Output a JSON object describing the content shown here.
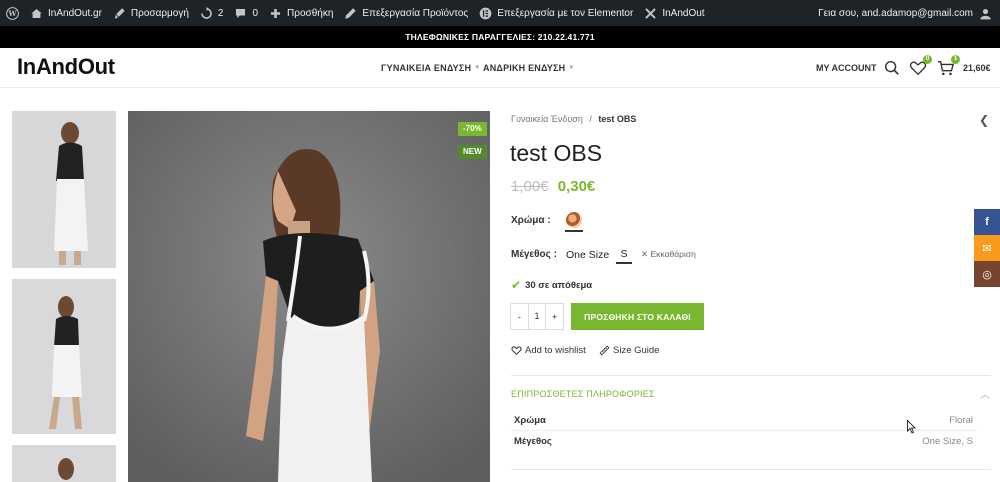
{
  "admin_bar": {
    "items": [
      {
        "icon": "wordpress-logo-icon",
        "label": ""
      },
      {
        "icon": "home-icon",
        "label": "InAndOut.gr"
      },
      {
        "icon": "paintbrush-icon",
        "label": "Προσαρμογή"
      },
      {
        "icon": "refresh-icon",
        "label": "2"
      },
      {
        "icon": "comment-icon",
        "label": "0"
      },
      {
        "icon": "plus-icon",
        "label": "Προσθήκη"
      },
      {
        "icon": "pencil-icon",
        "label": "Επεξεργασία Προϊόντος"
      },
      {
        "icon": "elementor-icon",
        "label": "Επεξεργασία με τον Elementor"
      },
      {
        "icon": "woodmart-icon",
        "label": "InAndOut"
      }
    ],
    "greeting": "Γεια σου, and.adamop@gmail.com"
  },
  "announcement": "ΤΗΛΕΦΩΝΙΚΕΣ ΠΑΡΑΓΓΕΛΙΕΣ: 210.22.41.771",
  "header": {
    "logo": "InAndOut",
    "nav": [
      "ΓΥΝΑΙΚΕΙΑ ΕΝΔΥΣΗ",
      "ΑΝΔΡΙΚΗ ΕΝΔΥΣΗ"
    ],
    "my_account": "MY ACCOUNT",
    "wishlist_count": "0",
    "cart_count": "1",
    "cart_total": "21,60€"
  },
  "product": {
    "badges": {
      "sale": "-70%",
      "new": "NEW"
    },
    "breadcrumb": {
      "parent": "Γυναικεία Ένδυση",
      "separator": "/",
      "current": "test OBS"
    },
    "title": "test OBS",
    "price_old": "1,00€",
    "price_new": "0,30€",
    "color_label": "Χρώμα :",
    "size_label": "Μέγεθος :",
    "sizes": [
      "One Size",
      "S"
    ],
    "clear_label": "Εκκαθάριση",
    "stock": "30 σε απόθεμα",
    "quantity": "1",
    "qty_minus": "-",
    "qty_plus": "+",
    "add_to_cart": "ΠΡΟΣΘΗΚΗ ΣΤΟ ΚΑΛΑΘΙ",
    "wishlist_link": "Add to wishlist",
    "size_guide_link": "Size Guide",
    "additional_info_title": "ΕΠΙΠΡΟΣΘΕΤΕΣ ΠΛΗΡΟΦΟΡΙΕΣ",
    "attributes": [
      {
        "label": "Χρώμα",
        "value": "Floral"
      },
      {
        "label": "Μέγεθος",
        "value": "One Size, S"
      }
    ]
  },
  "social": {
    "facebook": {
      "glyph": "f",
      "color": "#365493"
    },
    "email": {
      "glyph": "✉",
      "color": "#f89a1e"
    },
    "instagram": {
      "glyph": "◎",
      "color": "#774430"
    }
  },
  "colors": {
    "accent": "#7ab730",
    "admin_bar": "#1d2327"
  }
}
